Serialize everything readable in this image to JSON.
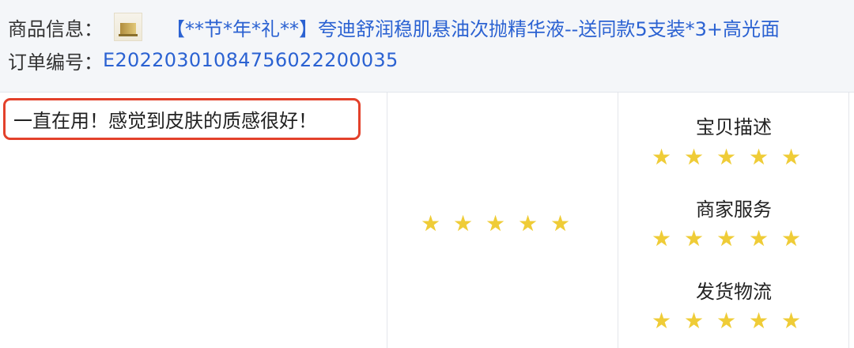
{
  "product": {
    "label": "商品信息：",
    "thumbnail_icon": "product-thumbnail",
    "title": "【**节*年*礼**】夸迪舒润稳肌悬油次抛精华液--送同款5支装*3+高光面"
  },
  "order": {
    "label": "订单编号：",
    "number": "E20220301084756022200035"
  },
  "review": {
    "text": "一直在用！感觉到皮肤的质感很好！"
  },
  "overall_rating": {
    "stars": 5,
    "max": 5
  },
  "dimensions": [
    {
      "label": "宝贝描述",
      "stars": 5,
      "max": 5
    },
    {
      "label": "商家服务",
      "stars": 5,
      "max": 5
    },
    {
      "label": "发货物流",
      "stars": 5,
      "max": 5
    }
  ],
  "colors": {
    "star": "#efcc37",
    "link": "#2b62d2",
    "highlight_border": "#e3412b",
    "header_bg": "#f4f6f9"
  }
}
